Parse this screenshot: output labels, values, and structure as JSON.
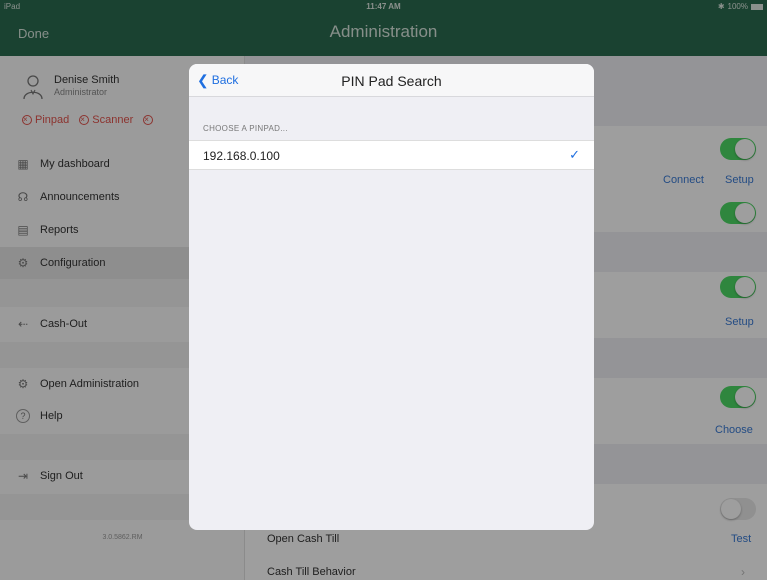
{
  "status": {
    "carrier": "iPad",
    "time": "11:47 AM",
    "battery": "100%"
  },
  "nav": {
    "done": "Done",
    "title": "Administration"
  },
  "user": {
    "name": "Denise Smith",
    "role": "Administrator"
  },
  "devices": {
    "pinpad": "Pinpad",
    "scanner": "Scanner"
  },
  "sidebar": {
    "items": [
      {
        "label": "My dashboard"
      },
      {
        "label": "Announcements"
      },
      {
        "label": "Reports"
      },
      {
        "label": "Configuration"
      },
      {
        "label": "Cash-Out"
      },
      {
        "label": "Open Administration"
      },
      {
        "label": "Help"
      },
      {
        "label": "Sign Out"
      }
    ],
    "build": "3.0.5862.RM"
  },
  "main": {
    "connect": "Connect",
    "setup1": "Setup",
    "setup2": "Setup",
    "choose": "Choose",
    "open_cash_till": "Open Cash Till",
    "test": "Test",
    "cash_till_behavior": "Cash Till Behavior"
  },
  "modal": {
    "back": "Back",
    "title": "PIN Pad Search",
    "section": "CHOOSE A PINPAD...",
    "pinpads": [
      {
        "address": "192.168.0.100",
        "selected": true
      }
    ]
  },
  "colors": {
    "accent": "#1f6fe0",
    "nav_green": "#2a6b4f",
    "toggle_on": "#4cd964",
    "error": "#e2534c"
  }
}
